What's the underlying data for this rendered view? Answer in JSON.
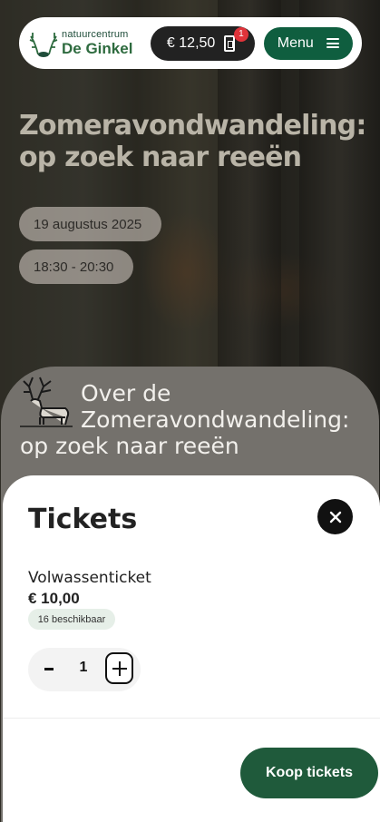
{
  "header": {
    "logo_small": "natuurcentrum",
    "logo_big": "De Ginkel",
    "cart_total": "€ 12,50",
    "cart_count": "1",
    "menu_label": "Menu"
  },
  "event": {
    "title": "Zomeravondwandeling: op zoek naar reeën",
    "date": "19 augustus 2025",
    "time": "18:30 - 20:30"
  },
  "about": {
    "title_line1": "Over de",
    "title_rest": "Zomeravondwandeling: op zoek naar reeën"
  },
  "tickets": {
    "title": "Tickets",
    "items": [
      {
        "name": "Volwassenticket",
        "price": "€ 10,00",
        "availability": "16 beschikbaar",
        "quantity": "1"
      }
    ],
    "buy_label": "Koop tickets"
  },
  "colors": {
    "brand_green": "#0f5e3f",
    "buy_green": "#1f5a3b",
    "badge_red": "#e0333a"
  },
  "icons": [
    "deer-logo-icon",
    "ticket-icon",
    "menu-icon",
    "reindeer-icon",
    "close-icon",
    "minus-icon",
    "plus-icon"
  ]
}
